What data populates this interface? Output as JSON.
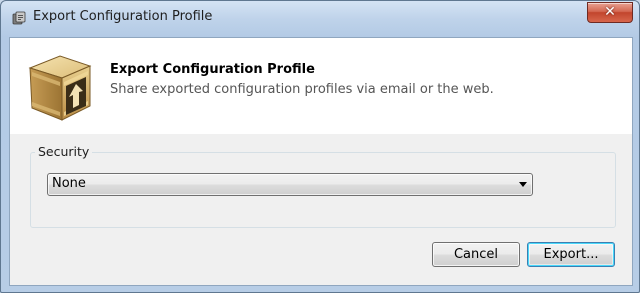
{
  "window": {
    "title": "Export Configuration Profile",
    "icon": "app-icon",
    "close_glyph": "✕"
  },
  "header": {
    "icon": "shipping-box-upload-icon",
    "title": "Export Configuration Profile",
    "description": "Share exported configuration profiles via email or the web."
  },
  "security": {
    "group_label": "Security",
    "selected": "None"
  },
  "buttons": {
    "cancel": "Cancel",
    "export": "Export..."
  },
  "colors": {
    "accent_focus": "#3c7fb1",
    "close_red": "#c2452d"
  }
}
